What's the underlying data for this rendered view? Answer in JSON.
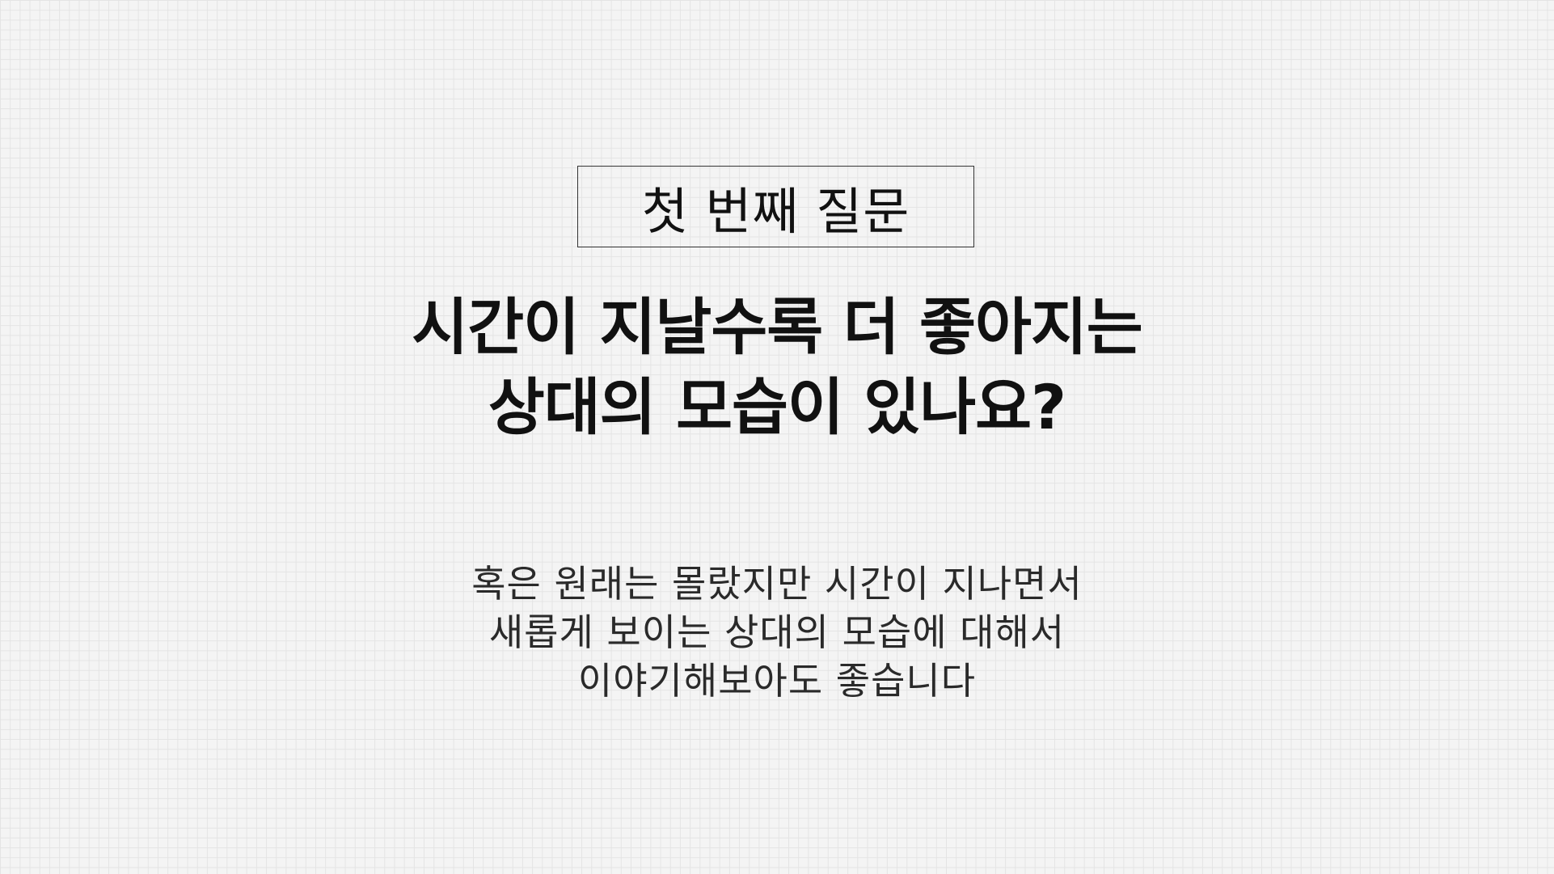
{
  "label": "첫 번째 질문",
  "question": {
    "lines": [
      "시간이 지날수록 더 좋아지는",
      "상대의 모습이 있나요?"
    ]
  },
  "description": {
    "lines": [
      "혹은 원래는 몰랐지만 시간이 지나면서",
      "새롭게 보이는 상대의 모습에 대해서",
      "이야기해보아도 좋습니다"
    ]
  }
}
